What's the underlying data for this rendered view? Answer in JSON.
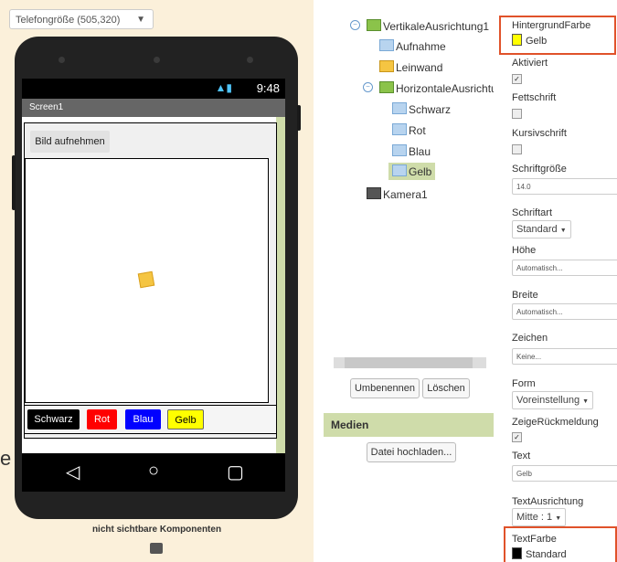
{
  "designer": {
    "size_select": "Telefongröße (505,320)",
    "status_time": "9:48",
    "screen_title": "Screen1",
    "button_label": "Bild aufnehmen",
    "color_buttons": [
      {
        "label": "Schwarz",
        "bg": "#000000",
        "fg": "#ffffff"
      },
      {
        "label": "Rot",
        "bg": "#ff0000",
        "fg": "#ffffff"
      },
      {
        "label": "Blau",
        "bg": "#0000ff",
        "fg": "#ffffff"
      },
      {
        "label": "Gelb",
        "bg": "#ffff00",
        "fg": "#000000"
      }
    ],
    "nav_back": "◁",
    "nav_home": "○",
    "nav_recent": "▢",
    "nonvisible_label": "nicht sichtbare Komponenten",
    "edge_text": "e"
  },
  "tree": {
    "items": [
      {
        "label": "VertikaleAusrichtung1",
        "icon": "vertical-arrangement-icon"
      },
      {
        "label": "Aufnahme",
        "icon": "button-icon"
      },
      {
        "label": "Leinwand",
        "icon": "canvas-icon"
      },
      {
        "label": "HorizontaleAusrichtun",
        "icon": "horizontal-arrangement-icon"
      },
      {
        "label": "Schwarz",
        "icon": "button-icon"
      },
      {
        "label": "Rot",
        "icon": "button-icon"
      },
      {
        "label": "Blau",
        "icon": "button-icon"
      },
      {
        "label": "Gelb",
        "icon": "button-icon"
      },
      {
        "label": "Kamera1",
        "icon": "camera-icon"
      }
    ],
    "rename_button": "Umbenennen",
    "delete_button": "Löschen"
  },
  "media": {
    "header": "Medien",
    "upload_button": "Datei hochladen..."
  },
  "properties": {
    "hintergrundfarbe_label": "HintergrundFarbe",
    "hintergrundfarbe_value": "Gelb",
    "hintergrundfarbe_color": "#ffff00",
    "aktiviert_label": "Aktiviert",
    "fettschrift_label": "Fettschrift",
    "kursivschrift_label": "Kursivschrift",
    "schriftgroesse_label": "Schriftgröße",
    "schriftgroesse_value": "14.0",
    "schriftart_label": "Schriftart",
    "schriftart_value": "Standard",
    "hoehe_label": "Höhe",
    "hoehe_value": "Automatisch...",
    "breite_label": "Breite",
    "breite_value": "Automatisch...",
    "zeichen_label": "Zeichen",
    "zeichen_value": "Keine...",
    "form_label": "Form",
    "form_value": "Voreinstellung",
    "zeige_label": "ZeigeRückmeldung",
    "text_label": "Text",
    "text_value": "Gelb",
    "textausrichtung_label": "TextAusrichtung",
    "textausrichtung_value": "Mitte : 1",
    "textfarbe_label": "TextFarbe",
    "textfarbe_value": "Standard",
    "textfarbe_color": "#000000",
    "highlight_color": "#e0522a"
  }
}
